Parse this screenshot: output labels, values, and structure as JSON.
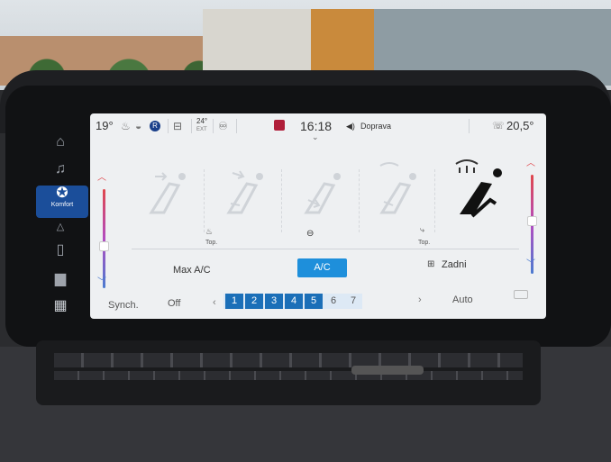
{
  "status": {
    "outside_temp": "19°",
    "ext_temp": "24°",
    "ext_label": "EXT",
    "time": "16:18",
    "nav_prompt": "Doprava",
    "right_temp": "20,5°"
  },
  "rail": {
    "active_label": "Komfort",
    "items": [
      "home-icon",
      "music-icon",
      "comfort-icon",
      "navigation-icon",
      "phone-icon",
      "car-icon",
      "apps-grid-icon"
    ]
  },
  "seats": {
    "top_label_1": "Top.",
    "top_label_2": "Top."
  },
  "controls": {
    "max_ac": "Max A/C",
    "ac": "A/C",
    "rear": "Zadni"
  },
  "fan": {
    "synch": "Synch.",
    "off": "Off",
    "levels": [
      "1",
      "2",
      "3",
      "4",
      "5",
      "6",
      "7"
    ],
    "active_level": 5,
    "auto": "Auto",
    "prev": "‹",
    "next": "›"
  },
  "colors": {
    "accent": "#1e8fdb",
    "rail_active": "#1b4e9a",
    "hot": "#e0474c",
    "cold": "#4b7bd0"
  }
}
